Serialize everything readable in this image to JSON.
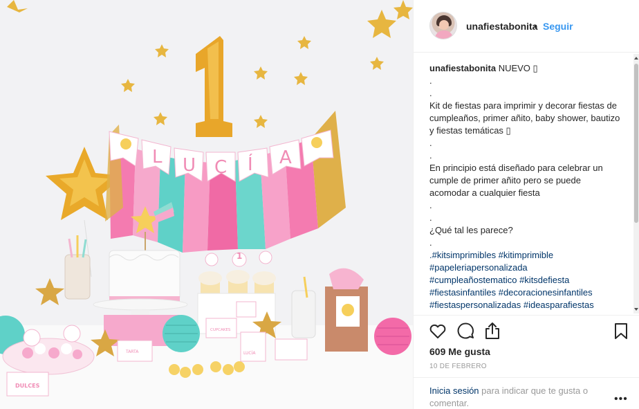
{
  "header": {
    "username": "unafiestabonita",
    "separator": "•",
    "follow_label": "Seguir"
  },
  "caption": {
    "username": "unafiestabonita",
    "first_text": " NUEVO ▯",
    "lines": [
      ".",
      ".",
      "Kit de fiestas para imprimir y decorar fiestas de cumpleaños, primer añito, baby shower, bautizo y fiestas temáticas ▯",
      ".",
      ".",
      "En principio está diseñado para celebrar un cumple de primer añito pero se puede acomodar a cualquier fiesta",
      ".",
      ".",
      "¿Qué tal les parece?",
      "."
    ],
    "hashtag_lines": [
      ".#kitsimprimibles #kitimprimible",
      "#papeleriapersonalizada",
      "#cumpleañostematico #kitsdefiesta",
      "#fiestasinfantiles #decoracionesinfantiles",
      "#fiestaspersonalizadas #ideasparafiestas"
    ]
  },
  "stats": {
    "likes": "609 Me gusta",
    "date": "10 DE FEBRERO"
  },
  "comment": {
    "login_link": "Inicia sesión",
    "rest": " para indicar que te gusta o comentar.",
    "more": "•••"
  },
  "photo": {
    "balloon_number": "1",
    "banner_letters": [
      "L",
      "U",
      "C",
      "Í",
      "A"
    ],
    "labels": {
      "dulces": "DULCES",
      "tarta": "TARTA",
      "cupcakes": "CUPCAKES",
      "lucia": "LUCÍA"
    }
  },
  "colors": {
    "link_blue": "#3897f0",
    "hashtag": "#003569",
    "gold": "#e8b23a",
    "pink": "#f48fb8",
    "teal": "#5fd1c8"
  },
  "icons": [
    "heart-icon",
    "comment-icon",
    "share-icon",
    "bookmark-icon",
    "more-icon"
  ]
}
